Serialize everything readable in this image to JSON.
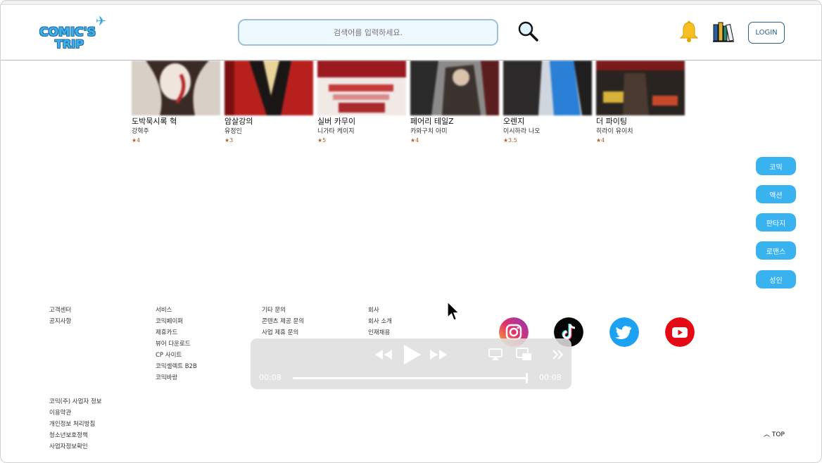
{
  "header": {
    "logo_line1": "COMIC'S",
    "logo_line2": "TRIP",
    "search_placeholder": "검색어를 입력하세요.",
    "login_label": "LOGIN"
  },
  "comics": [
    {
      "title": "도박묵시록 혁",
      "author": "강혁주",
      "rating": "4"
    },
    {
      "title": "암살강의",
      "author": "유정인",
      "rating": "3"
    },
    {
      "title": "실버 카무이",
      "author": "니가타 케이지",
      "rating": "5"
    },
    {
      "title": "페어리 테일Z",
      "author": "카와구치 아미",
      "rating": "4"
    },
    {
      "title": "오렌지",
      "author": "이시하라 나오",
      "rating": "3.5"
    },
    {
      "title": "더 파이팅",
      "author": "히라이 유이치",
      "rating": "4"
    }
  ],
  "genres": [
    "코믹",
    "액션",
    "판타지",
    "로맨스",
    "성인"
  ],
  "footer": {
    "col1": [
      "고객센터",
      "공지사항"
    ],
    "col2": [
      "서비스",
      "코믹페이퍼",
      "제휴카드",
      "뷰어 다운로드",
      "CP 사이트",
      "코믹셀렉트 B2B",
      "코믹바랑"
    ],
    "col3": [
      "기타 문의",
      "콘텐츠 제공 문의",
      "사업 제휴 문의"
    ],
    "col4": [
      "회사",
      "회사 소개",
      "인재채용"
    ],
    "biz": [
      "코믹(주) 사업자 정보",
      "이용약관",
      "개인정보 처리방침",
      "청소년보호정책",
      "사업자정보확인"
    ],
    "top_label": "TOP"
  },
  "player": {
    "elapsed": "00:08",
    "duration": "00:08",
    "progress": 1.0
  },
  "social": [
    "instagram-icon",
    "tiktok-icon",
    "twitter-icon",
    "youtube-icon"
  ],
  "colors": {
    "accent": "#39b3f0",
    "rating": "#b3612a",
    "login_border": "#2a5f86",
    "search_bg": "#eef8ff"
  }
}
